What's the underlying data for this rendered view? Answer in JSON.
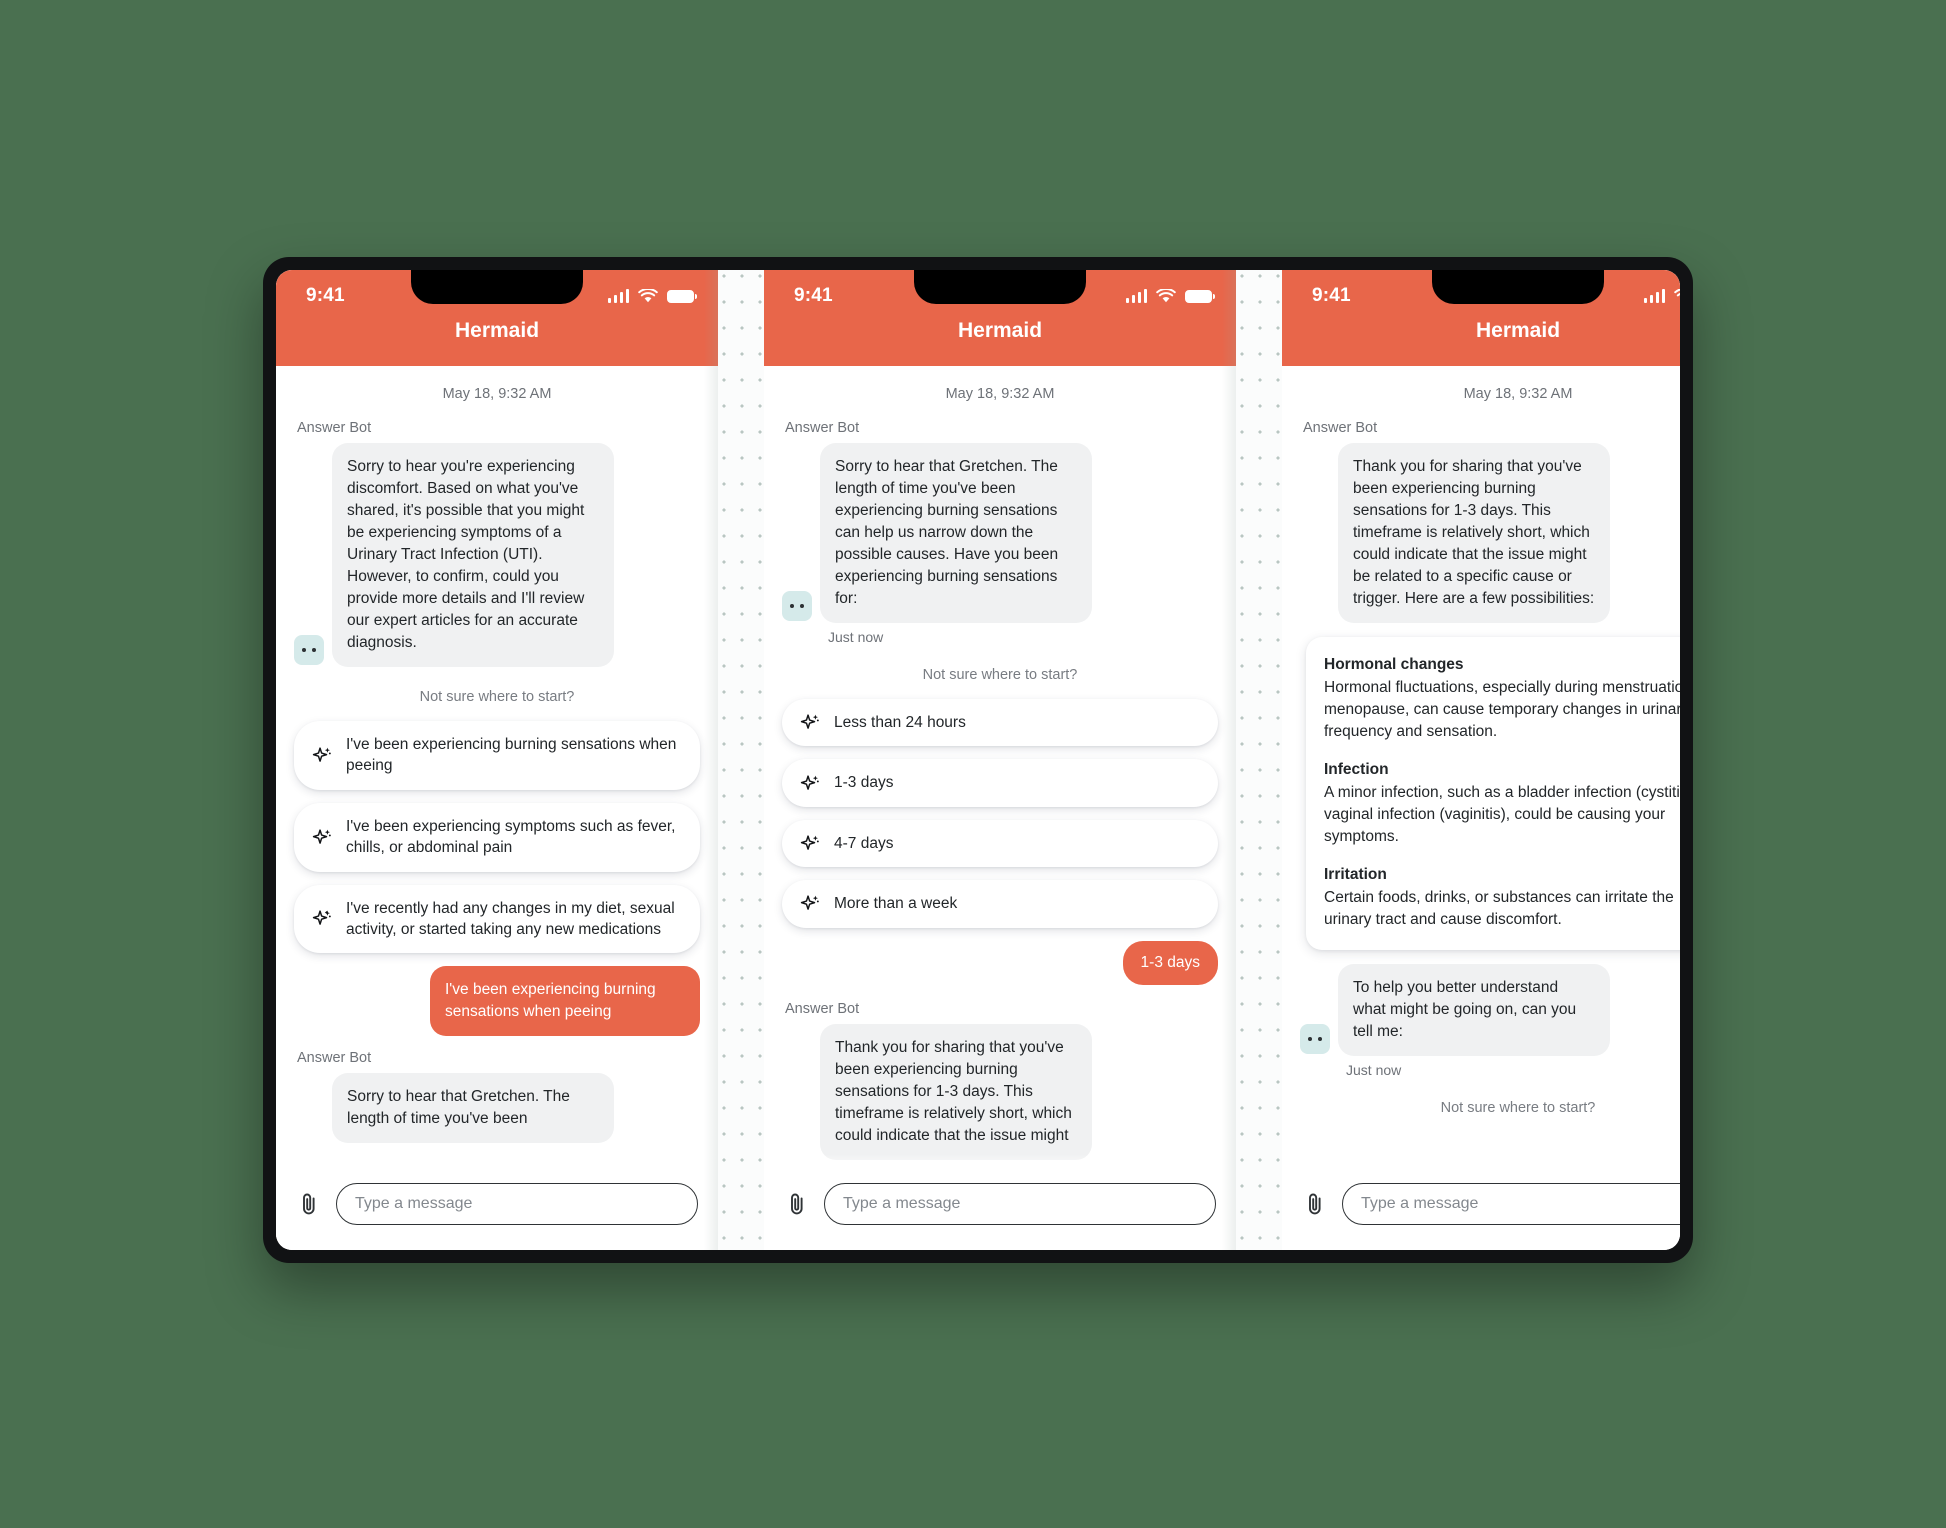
{
  "app": {
    "title": "Hermaid",
    "accent_color": "#e8664a",
    "bot_bubble_color": "#f0f1f2",
    "avatar_color": "#d5eaea",
    "background_color": "#4a7050"
  },
  "status_bar": {
    "time": "9:41",
    "signal_icon": "cellular-bars-icon",
    "wifi_icon": "wifi-icon",
    "battery_icon": "battery-icon"
  },
  "composer": {
    "attach_icon": "paperclip-icon",
    "placeholder": "Type a message"
  },
  "common": {
    "daystamp": "May 18, 9:32 AM",
    "sender": "Answer Bot",
    "prompt_label": "Not sure where to start?",
    "just_now": "Just now",
    "sparkle_icon": "sparkle-icon"
  },
  "panel1": {
    "daystamp": "May 18, 9:32 AM",
    "sender_1": "Answer Bot",
    "bot_message_1": "Sorry to hear you're experiencing discomfort. Based on what you've shared, it's possible that you might be experiencing symptoms of a Urinary Tract Infection (UTI). However, to confirm, could you provide more details and I'll review our expert articles for an accurate diagnosis.",
    "prompt_label": "Not sure where to start?",
    "suggestions": [
      "I've been experiencing burning sensations when peeing",
      "I've been experiencing symptoms such as fever, chills, or abdominal pain",
      "I've recently had any changes in my diet, sexual activity, or started taking any new medications"
    ],
    "user_message": "I've been experiencing burning sensations when peeing",
    "sender_2": "Answer Bot",
    "bot_message_2": "Sorry to hear that Gretchen. The length of time you've been"
  },
  "panel2": {
    "daystamp": "May 18, 9:32 AM",
    "sender_1": "Answer Bot",
    "bot_message_1": "Sorry to hear that Gretchen. The length of time you've been experiencing burning sensations can help us narrow down the possible causes. Have you been experiencing burning sensations for:",
    "timestamp_1": "Just now",
    "prompt_label": "Not sure where to start?",
    "options": [
      "Less than 24 hours",
      "1-3 days",
      "4-7 days",
      "More than a week"
    ],
    "user_selection": "1-3 days",
    "sender_2": "Answer Bot",
    "bot_message_2": "Thank you for sharing that you've been experiencing burning sensations for 1-3 days. This timeframe is relatively short, which could indicate that the issue might"
  },
  "panel3": {
    "daystamp": "May 18, 9:32 AM",
    "sender_1": "Answer Bot",
    "bot_message_1": "Thank you for sharing that you've been experiencing burning sensations for 1-3 days. This timeframe is relatively short, which could indicate that the issue might be related to a specific cause or trigger. Here are a few possibilities:",
    "causes": [
      {
        "heading": "Hormonal changes",
        "body": "Hormonal fluctuations, especially during menstruation or menopause, can cause temporary changes in urinary frequency and sensation."
      },
      {
        "heading": "Infection",
        "body": "A minor infection, such as a bladder infection (cystitis) or vaginal infection (vaginitis), could be causing your symptoms."
      },
      {
        "heading": "Irritation",
        "body": "Certain foods, drinks, or substances can irritate the urinary tract and cause discomfort."
      }
    ],
    "bot_message_2": "To help you better understand what might be going on, can you tell me:",
    "timestamp_2": "Just now",
    "prompt_label": "Not sure where to start?"
  }
}
